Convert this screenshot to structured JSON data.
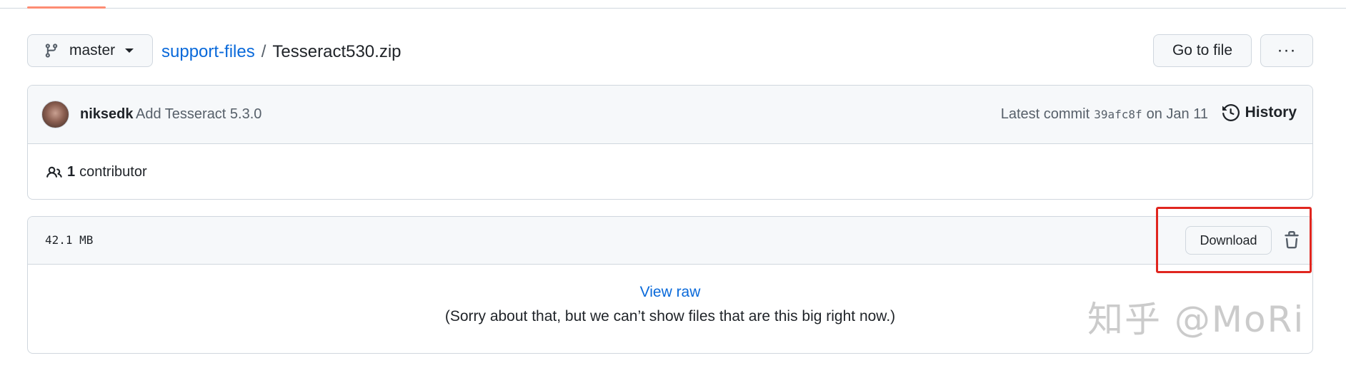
{
  "branch": {
    "name": "master",
    "icon": "git-branch-icon"
  },
  "breadcrumb": {
    "repo": "support-files",
    "separator": "/",
    "file": "Tesseract530.zip"
  },
  "actions": {
    "go_to_file": "Go to file",
    "more": "···"
  },
  "commit": {
    "author": "niksedk",
    "message": "Add Tesseract 5.3.0",
    "latest_label": "Latest commit",
    "sha": "39afc8f",
    "date": "on Jan 11",
    "history_label": "History"
  },
  "contributors": {
    "count": "1",
    "label": "contributor"
  },
  "file": {
    "size": "42.1 MB",
    "download_label": "Download",
    "view_raw": "View raw",
    "too_big_message": "(Sorry about that, but we can’t show files that are this big right now.)"
  },
  "watermark": "知乎 @MoRi",
  "colors": {
    "link": "#0969da",
    "highlight": "#e0261f",
    "border": "#d0d7de",
    "header_bg": "#f6f8fa"
  }
}
